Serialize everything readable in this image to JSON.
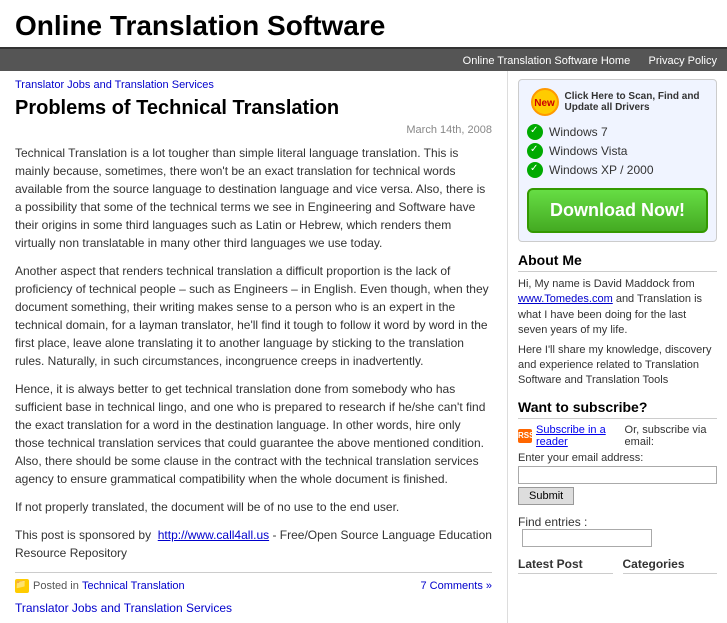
{
  "header": {
    "title": "Online Translation Software"
  },
  "topnav": {
    "items": [
      {
        "label": "Online Translation Software Home",
        "href": "#"
      },
      {
        "label": "Privacy Policy",
        "href": "#"
      }
    ]
  },
  "breadcrumb": {
    "label": "Translator Jobs and Translation Services"
  },
  "post": {
    "title": "Problems of Technical Translation",
    "date": "March 14th, 2008",
    "paragraphs": [
      "Technical Translation is a lot tougher than simple literal language translation. This is mainly because, sometimes, there won't be an exact translation for technical words available from the source language to destination language and vice versa. Also, there is a possibility that some of the technical terms we see in Engineering and Software have their origins in some third languages such as Latin or Hebrew, which renders them virtually non translatable in many other third languages we use today.",
      "Another aspect that renders technical translation a difficult proportion is the lack of proficiency of technical people – such as Engineers – in English. Even though, when they document something, their writing makes sense to a person who is an expert in the technical domain, for a layman translator, he'll find it tough to follow it word by word in the first place, leave alone translating it to another language by sticking to the translation rules. Naturally, in such circumstances, incongruence creeps in inadvertently.",
      "Hence, it is always better to get technical translation done from somebody who has sufficient base in technical lingo, and one who is prepared to research if he/she can't find the exact translation for a word in the destination language. In other words, hire only those technical translation services that could guarantee the above mentioned condition. Also, there should be some clause in the contract with the technical translation services agency to ensure grammatical compatibility when the whole document is finished.",
      "If not properly translated, the document will be of no use to the end user.",
      "This post is sponsored by  http://www.call4all.us - Free/Open Source Language Education Resource Repository"
    ],
    "sponsored_link_text": "http://www.call4all.us",
    "sponsored_link_suffix": " - Free/Open Source Language Education Resource Repository",
    "footer_category": "Technical Translation",
    "footer_comments": "7 Comments »"
  },
  "next_post": {
    "label": "Translator Jobs and Translation Services"
  },
  "sidebar": {
    "ad": {
      "badge": "New",
      "text": "Click Here to Scan, Find and Update all Drivers",
      "windows": [
        "Windows  7",
        "Windows  Vista",
        "Windows  XP / 2000"
      ],
      "download_btn": "Download Now!"
    },
    "about": {
      "heading": "About Me",
      "text": "Hi, My name is David Maddock from ",
      "link_text": "www.Tomedes.com",
      "text2": " and Translation is what I have been doing for the last seven years of my life.",
      "text3": "Here I'll share my knowledge, discovery and experience related to Translation Software and Translation Tools"
    },
    "subscribe": {
      "heading": "Want to subscribe?",
      "rss_text": "Subscribe in a reader",
      "or_text": "Or, subscribe via email:",
      "email_label": "Enter your email address:",
      "email_placeholder": "",
      "submit_label": "Submit"
    },
    "find": {
      "label": "Find entries :"
    },
    "bottom": {
      "latest_post": "Latest Post",
      "categories": "Categories"
    }
  }
}
